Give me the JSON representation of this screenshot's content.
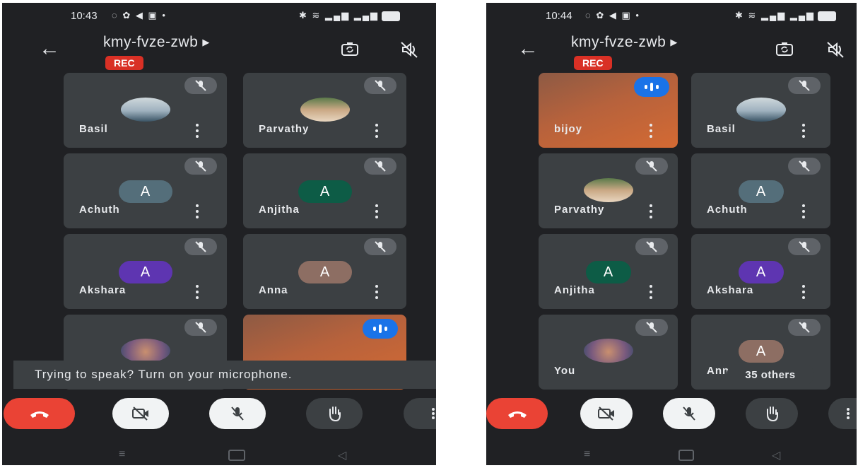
{
  "screens": [
    {
      "status": {
        "time": "10:43"
      },
      "header": {
        "meeting_code": "kmy-fvze-zwb",
        "rec_label": "REC"
      },
      "tiles": [
        {
          "name": "Basil"
        },
        {
          "name": "Parvathy"
        },
        {
          "name": "Achuth",
          "letter": "A"
        },
        {
          "name": "Anjitha",
          "letter": "A"
        },
        {
          "name": "Akshara",
          "letter": "A"
        },
        {
          "name": "Anna",
          "letter": "A"
        }
      ],
      "toast": "Trying to speak? Turn on your microphone."
    },
    {
      "status": {
        "time": "10:44"
      },
      "header": {
        "meeting_code": "kmy-fvze-zwb",
        "rec_label": "REC"
      },
      "tiles": [
        {
          "name": "bijoy"
        },
        {
          "name": "Basil"
        },
        {
          "name": "Parvathy"
        },
        {
          "name": "Achuth",
          "letter": "A"
        },
        {
          "name": "Anjitha",
          "letter": "A"
        },
        {
          "name": "Akshara",
          "letter": "A"
        },
        {
          "name": "You"
        },
        {
          "name": "Ann",
          "letter": "A"
        }
      ],
      "others_chip": "35 others"
    }
  ],
  "colors": {
    "background": "#202124",
    "tile": "#3c4043",
    "rec": "#d93025",
    "end_call": "#ea4335",
    "avatar_achuth": "#546e7a",
    "avatar_anjitha": "#0d5c46",
    "avatar_akshara": "#5e35b1",
    "avatar_anna": "#8d6e63",
    "speaking": "#1a73e8"
  },
  "icons": [
    "back-arrow-icon",
    "switch-camera-icon",
    "speaker-off-icon",
    "mic-off-icon",
    "speaking-indicator-icon",
    "more-vert-icon",
    "end-call-icon",
    "camera-off-icon",
    "raise-hand-icon",
    "home-nav-icon",
    "recents-nav-icon",
    "back-nav-icon"
  ]
}
